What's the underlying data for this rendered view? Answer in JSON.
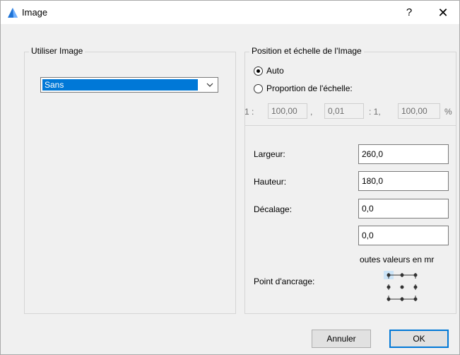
{
  "window": {
    "title": "Image",
    "help_label": "?",
    "close_label": "✕",
    "icon": "app-icon"
  },
  "usage": {
    "group_label": "Utiliser Image",
    "selected": "Sans"
  },
  "position": {
    "group_label": "Position et échelle de l'Image",
    "auto_label": "Auto",
    "proportion_label": "Proportion de l'échelle:",
    "selected_option": "Auto",
    "scale": {
      "prefix": "1 :",
      "value1": "100,00",
      "comma": ",",
      "value2": "0,01",
      "sep": ": 1,",
      "value3": "100,00",
      "unit": "%"
    }
  },
  "fields": {
    "width_label": "Largeur:",
    "width_value": "260,0",
    "height_label": "Hauteur:",
    "height_value": "180,0",
    "offset_label": "Décalage:",
    "offset_x": "0,0",
    "offset_y": "0,0",
    "units_note": "outes valeurs en mr",
    "anchor_label": "Point d'ancrage:",
    "anchor_selected": "top-left"
  },
  "buttons": {
    "cancel": "Annuler",
    "ok": "OK"
  },
  "colors": {
    "accent": "#0078d7",
    "anchor_highlight": "#cce4f7"
  }
}
